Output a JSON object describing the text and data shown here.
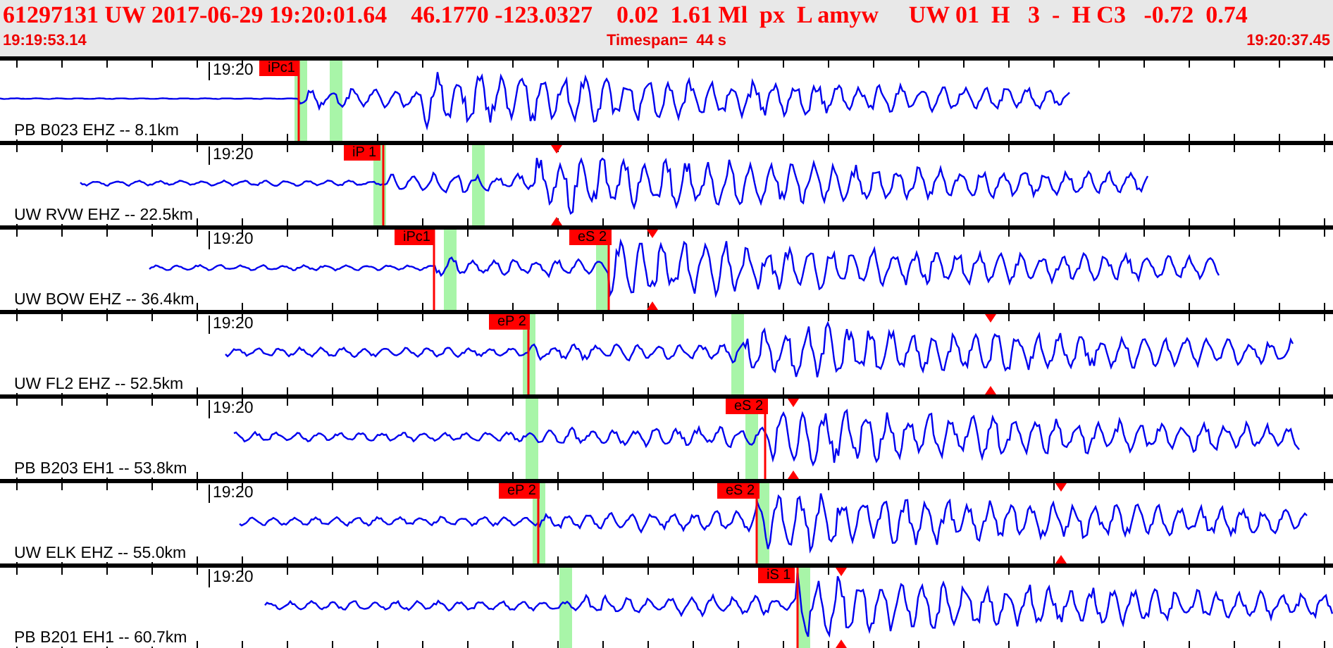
{
  "header": {
    "summary": "61297131 UW 2017-06-29 19:20:01.64    46.1770 -123.0327    0.02  1.61 Ml  px  L amyw     UW 01  H   3  -  H C3   -0.72  0.74",
    "start_time": "19:19:53.14",
    "timespan": "Timespan=  44 s",
    "end_time": "19:20:37.45"
  },
  "traces": [
    {
      "label": "PB B023 EHZ -- 8.1km",
      "time_label": "19:20",
      "picks": [
        {
          "label": "iPc1"
        }
      ]
    },
    {
      "label": "UW RVW EHZ -- 22.5km",
      "time_label": "19:20",
      "picks": [
        {
          "label": "iP 1"
        }
      ]
    },
    {
      "label": "UW BOW EHZ -- 36.4km",
      "time_label": "19:20",
      "picks": [
        {
          "label": "iPc1"
        },
        {
          "label": "eS 2"
        }
      ]
    },
    {
      "label": "UW FL2 EHZ -- 52.5km",
      "time_label": "19:20",
      "picks": [
        {
          "label": "eP 2"
        }
      ]
    },
    {
      "label": "PB B203 EH1 -- 53.8km",
      "time_label": "19:20",
      "picks": [
        {
          "label": "eS 2"
        }
      ]
    },
    {
      "label": "UW ELK EHZ -- 55.0km",
      "time_label": "19:20",
      "picks": [
        {
          "label": "eP 2"
        },
        {
          "label": "eS 2"
        }
      ]
    },
    {
      "label": "PB B201 EH1 -- 60.7km",
      "time_label": "19:20",
      "picks": [
        {
          "label": "iS 1"
        }
      ]
    }
  ]
}
